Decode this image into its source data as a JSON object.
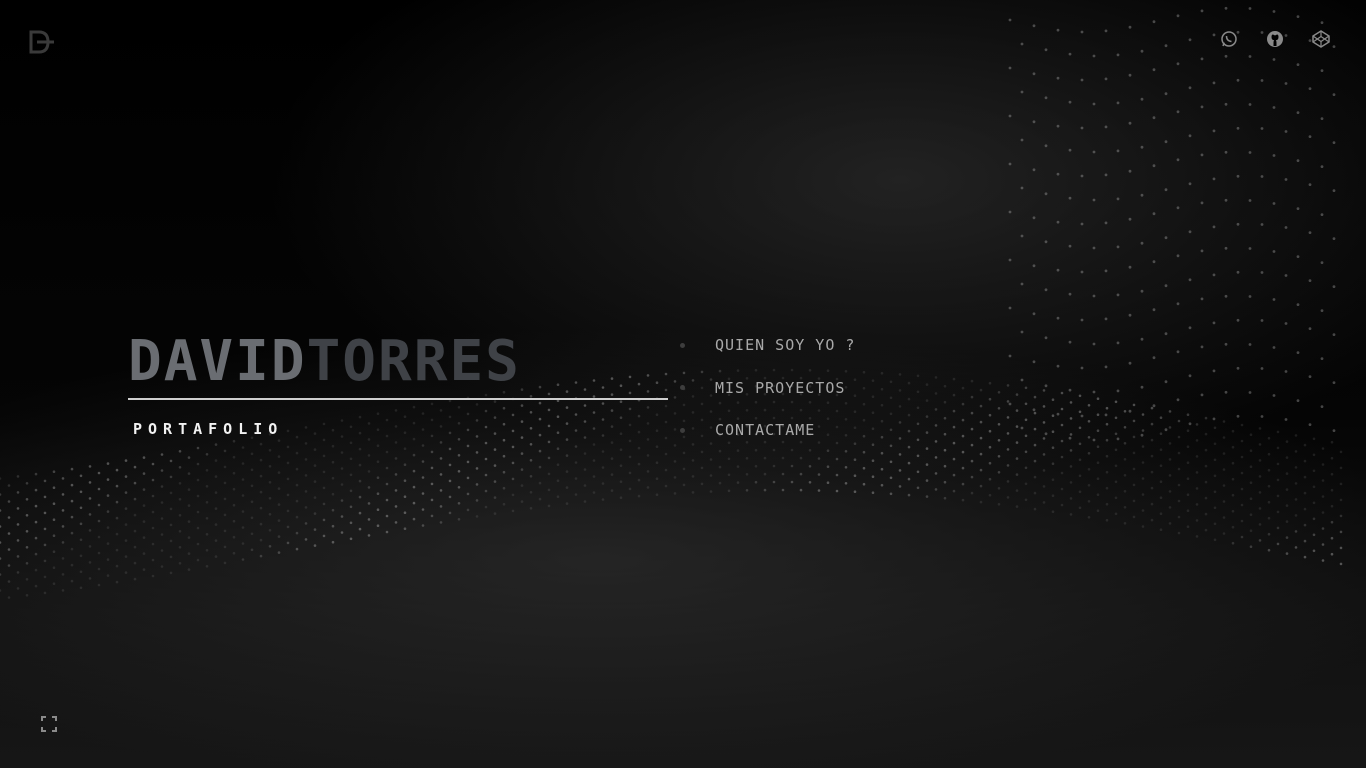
{
  "brand": {
    "logo_icon": "df-monogram-logo"
  },
  "social": [
    {
      "name": "whatsapp",
      "icon": "whatsapp-icon"
    },
    {
      "name": "github",
      "icon": "github-icon"
    },
    {
      "name": "codepen",
      "icon": "codepen-icon"
    }
  ],
  "hero": {
    "first_name": "DAVID",
    "last_name": "TORRES",
    "subtitle": "PORTAFOLIO"
  },
  "menu": [
    {
      "label": "QUIEN SOY YO ?"
    },
    {
      "label": "MIS PROYECTOS"
    },
    {
      "label": "CONTACTAME"
    }
  ],
  "controls": {
    "fullscreen_icon": "fullscreen-icon"
  },
  "colors": {
    "background": "#000000",
    "name_first": "#6a6d72",
    "name_last": "#3f4247",
    "rule": "#cfcfcf",
    "menu_text": "#a9a9a9",
    "icon": "#8a8a8a"
  }
}
